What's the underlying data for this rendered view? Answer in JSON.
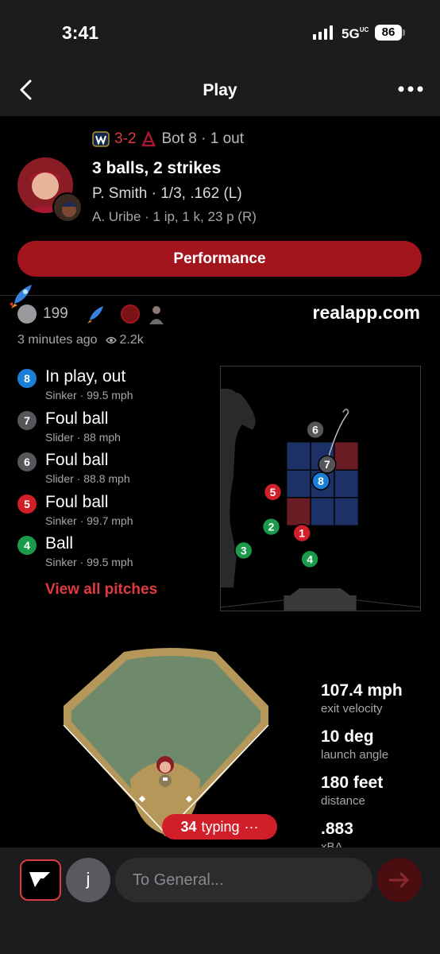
{
  "status_bar": {
    "time": "3:41",
    "network": "5G",
    "network_sup": "UC",
    "battery": "86"
  },
  "nav": {
    "title": "Play"
  },
  "play": {
    "score": "3-2",
    "situation": "Bot 8 · 1 out",
    "count": "3 balls, 2 strikes",
    "batter": "P. Smith · 1/3, .162 (L)",
    "pitcher": "A. Uribe · 1 ip, 1 k, 23 p (R)"
  },
  "performance_button": "Performance",
  "reactions": {
    "count": "199",
    "site": "realapp.com",
    "time_ago": "3 minutes ago",
    "views": "2.2k"
  },
  "pitches": [
    {
      "number": "8",
      "result": "In play, out",
      "detail": "Sinker · 99.5 mph",
      "color": "#1a7fd6"
    },
    {
      "number": "7",
      "result": "Foul ball",
      "detail": "Slider · 88 mph",
      "color": "#55555a"
    },
    {
      "number": "6",
      "result": "Foul ball",
      "detail": "Slider · 88.8 mph",
      "color": "#55555a"
    },
    {
      "number": "5",
      "result": "Foul ball",
      "detail": "Sinker · 99.7 mph",
      "color": "#d01f28"
    },
    {
      "number": "4",
      "result": "Ball",
      "detail": "Sinker · 99.5 mph",
      "color": "#1a9a4a"
    }
  ],
  "view_all": "View all pitches",
  "zone_markers": [
    {
      "n": "1",
      "color": "#d01f28"
    },
    {
      "n": "2",
      "color": "#1a9a4a"
    },
    {
      "n": "3",
      "color": "#1a9a4a"
    },
    {
      "n": "4",
      "color": "#1a9a4a"
    },
    {
      "n": "5",
      "color": "#d01f28"
    },
    {
      "n": "6",
      "color": "#55555a"
    },
    {
      "n": "7",
      "color": "#55555a"
    },
    {
      "n": "8",
      "color": "#1a7fd6"
    }
  ],
  "batted_ball": [
    {
      "value": "107.4 mph",
      "label": "exit velocity"
    },
    {
      "value": "10 deg",
      "label": "launch angle"
    },
    {
      "value": "180 feet",
      "label": "distance"
    },
    {
      "value": ".883",
      "label": "xBA"
    }
  ],
  "typing": {
    "count": "34",
    "label": "typing"
  },
  "composer": {
    "avatar_letter": "j",
    "placeholder": "To General..."
  }
}
